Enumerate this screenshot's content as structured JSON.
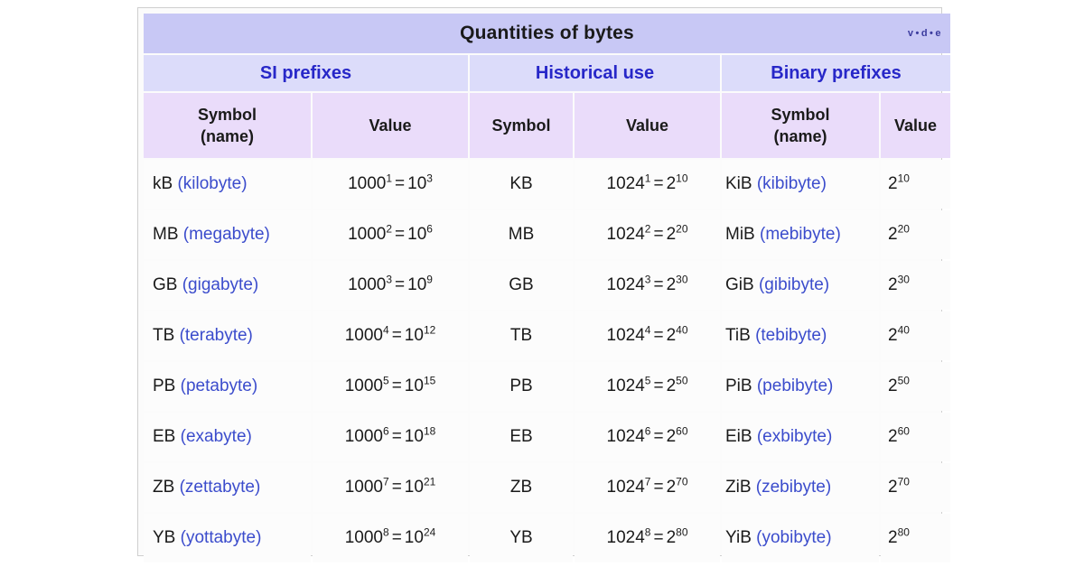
{
  "navbox": {
    "title": "Quantities of bytes",
    "nav_links": {
      "view": "v",
      "discuss": "d",
      "edit": "e",
      "separator": "•"
    },
    "group_headers": [
      "SI prefixes",
      "Historical use",
      "Binary prefixes"
    ],
    "column_headers": {
      "si_symbol_main": "Symbol",
      "si_symbol_sub": "(name)",
      "si_value": "Value",
      "hist_symbol": "Symbol",
      "hist_value": "Value",
      "bin_symbol_main": "Symbol",
      "bin_symbol_sub": "(name)",
      "bin_value": "Value"
    },
    "rows": [
      {
        "si_symbol": "kB",
        "si_name": "(kilobyte)",
        "si_base": "1000",
        "si_exp": "1",
        "si_eq": "=",
        "si_rbase": "10",
        "si_rexp": "3",
        "hist_symbol": "KB",
        "hist_base": "1024",
        "hist_exp": "1",
        "hist_eq": "=",
        "hist_rbase": "2",
        "hist_rexp": "10",
        "bin_symbol": "KiB",
        "bin_name": "(kibibyte)",
        "bin_base": "2",
        "bin_exp": "10"
      },
      {
        "si_symbol": "MB",
        "si_name": "(megabyte)",
        "si_base": "1000",
        "si_exp": "2",
        "si_eq": "=",
        "si_rbase": "10",
        "si_rexp": "6",
        "hist_symbol": "MB",
        "hist_base": "1024",
        "hist_exp": "2",
        "hist_eq": "=",
        "hist_rbase": "2",
        "hist_rexp": "20",
        "bin_symbol": "MiB",
        "bin_name": "(mebibyte)",
        "bin_base": "2",
        "bin_exp": "20"
      },
      {
        "si_symbol": "GB",
        "si_name": "(gigabyte)",
        "si_base": "1000",
        "si_exp": "3",
        "si_eq": "=",
        "si_rbase": "10",
        "si_rexp": "9",
        "hist_symbol": "GB",
        "hist_base": "1024",
        "hist_exp": "3",
        "hist_eq": "=",
        "hist_rbase": "2",
        "hist_rexp": "30",
        "bin_symbol": "GiB",
        "bin_name": "(gibibyte)",
        "bin_base": "2",
        "bin_exp": "30"
      },
      {
        "si_symbol": "TB",
        "si_name": "(terabyte)",
        "si_base": "1000",
        "si_exp": "4",
        "si_eq": "=",
        "si_rbase": "10",
        "si_rexp": "12",
        "hist_symbol": "TB",
        "hist_base": "1024",
        "hist_exp": "4",
        "hist_eq": "=",
        "hist_rbase": "2",
        "hist_rexp": "40",
        "bin_symbol": "TiB",
        "bin_name": "(tebibyte)",
        "bin_base": "2",
        "bin_exp": "40"
      },
      {
        "si_symbol": "PB",
        "si_name": "(petabyte)",
        "si_base": "1000",
        "si_exp": "5",
        "si_eq": "=",
        "si_rbase": "10",
        "si_rexp": "15",
        "hist_symbol": "PB",
        "hist_base": "1024",
        "hist_exp": "5",
        "hist_eq": "=",
        "hist_rbase": "2",
        "hist_rexp": "50",
        "bin_symbol": "PiB",
        "bin_name": "(pebibyte)",
        "bin_base": "2",
        "bin_exp": "50"
      },
      {
        "si_symbol": "EB",
        "si_name": "(exabyte)",
        "si_base": "1000",
        "si_exp": "6",
        "si_eq": "=",
        "si_rbase": "10",
        "si_rexp": "18",
        "hist_symbol": "EB",
        "hist_base": "1024",
        "hist_exp": "6",
        "hist_eq": "=",
        "hist_rbase": "2",
        "hist_rexp": "60",
        "bin_symbol": "EiB",
        "bin_name": "(exbibyte)",
        "bin_base": "2",
        "bin_exp": "60"
      },
      {
        "si_symbol": "ZB",
        "si_name": "(zettabyte)",
        "si_base": "1000",
        "si_exp": "7",
        "si_eq": "=",
        "si_rbase": "10",
        "si_rexp": "21",
        "hist_symbol": "ZB",
        "hist_base": "1024",
        "hist_exp": "7",
        "hist_eq": "=",
        "hist_rbase": "2",
        "hist_rexp": "70",
        "bin_symbol": "ZiB",
        "bin_name": "(zebibyte)",
        "bin_base": "2",
        "bin_exp": "70"
      },
      {
        "si_symbol": "YB",
        "si_name": "(yottabyte)",
        "si_base": "1000",
        "si_exp": "8",
        "si_eq": "=",
        "si_rbase": "10",
        "si_rexp": "24",
        "hist_symbol": "YB",
        "hist_base": "1024",
        "hist_exp": "8",
        "hist_eq": "=",
        "hist_rbase": "2",
        "hist_rexp": "80",
        "bin_symbol": "YiB",
        "bin_name": "(yobibyte)",
        "bin_base": "2",
        "bin_exp": "80"
      }
    ]
  },
  "colors": {
    "title_bg": "#c8c8f5",
    "group_bg": "#dcdcfa",
    "colhead_bg": "#eadcfa",
    "data_bg": "#fcfcfc",
    "link_blue": "#3b4ccc",
    "group_blue": "#2727c8",
    "page_bg": "#ffffff"
  }
}
